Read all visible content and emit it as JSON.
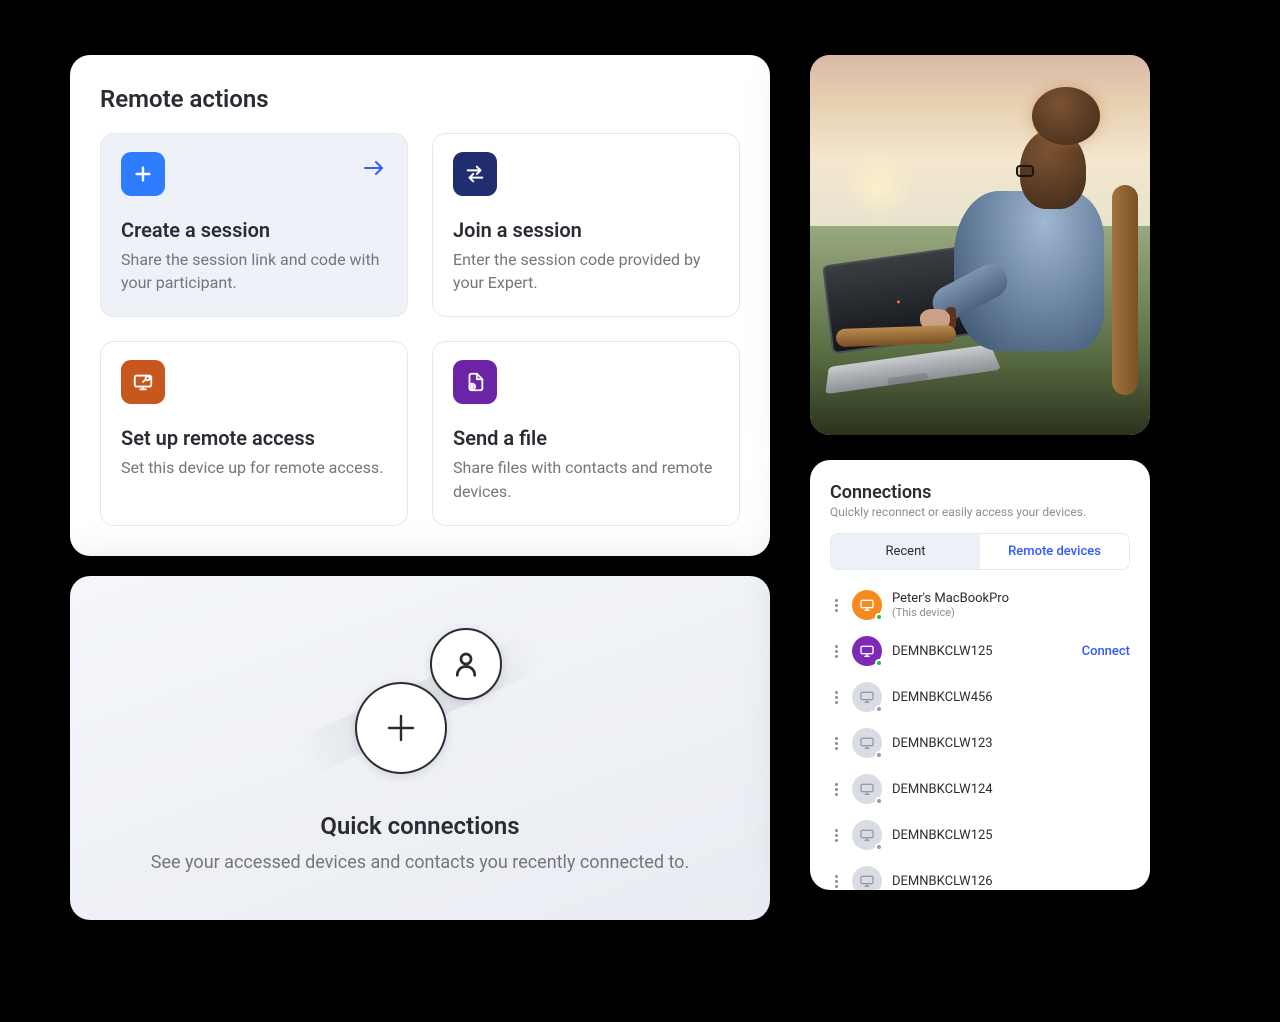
{
  "remoteActions": {
    "title": "Remote actions",
    "cards": {
      "create": {
        "title": "Create a session",
        "desc": "Share the session link and code with your participant."
      },
      "join": {
        "title": "Join a session",
        "desc": "Enter the session code provided by your Expert."
      },
      "setup": {
        "title": "Set up remote access",
        "desc": "Set this device up for remote access."
      },
      "send": {
        "title": "Send a file",
        "desc": "Share files with contacts and remote devices."
      }
    },
    "icons": {
      "create": "plus-icon",
      "join": "swap-icon",
      "setup": "monitor-share-icon",
      "send": "file-send-icon"
    },
    "colors": {
      "create": "#2f7dff",
      "join": "#202d6e",
      "setup": "#c8571d",
      "send": "#6a24a5",
      "arrow_accent": "#2f5bff"
    }
  },
  "quickConnections": {
    "title": "Quick connections",
    "sub": "See your accessed devices and contacts you recently connected to."
  },
  "connections": {
    "title": "Connections",
    "sub": "Quickly reconnect or easily access your devices.",
    "tabs": {
      "recent": "Recent",
      "remote": "Remote devices"
    },
    "action_connect": "Connect",
    "devices": [
      {
        "name": "Peter's MacBookPro",
        "note": "(This device)",
        "icon_color": "orange",
        "status": "online",
        "action": ""
      },
      {
        "name": "DEMNBKCLW125",
        "note": "",
        "icon_color": "purple2",
        "status": "online",
        "action": "Connect"
      },
      {
        "name": "DEMNBKCLW456",
        "note": "",
        "icon_color": "grey",
        "status": "offline",
        "action": ""
      },
      {
        "name": "DEMNBKCLW123",
        "note": "",
        "icon_color": "grey",
        "status": "offline",
        "action": ""
      },
      {
        "name": "DEMNBKCLW124",
        "note": "",
        "icon_color": "grey",
        "status": "offline",
        "action": ""
      },
      {
        "name": "DEMNBKCLW125",
        "note": "",
        "icon_color": "grey",
        "status": "offline",
        "action": ""
      },
      {
        "name": "DEMNBKCLW126",
        "note": "",
        "icon_color": "grey",
        "status": "offline",
        "action": ""
      }
    ]
  }
}
